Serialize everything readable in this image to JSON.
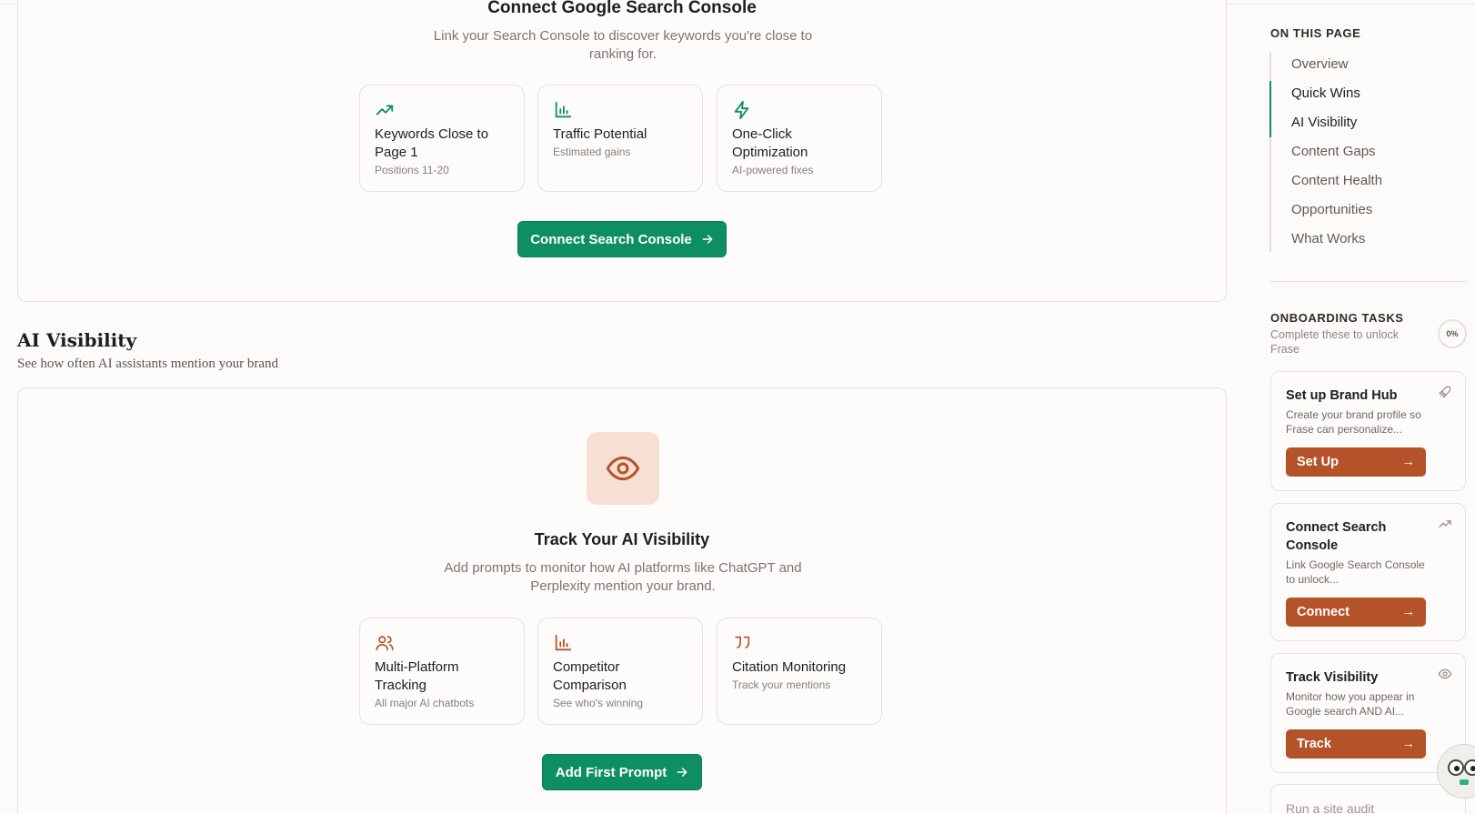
{
  "gsc_section": {
    "title": "Connect Google Search Console",
    "description": "Link your Search Console to discover keywords you're close to ranking for.",
    "features": [
      {
        "icon": "trending-up-icon",
        "title": "Keywords Close to Page 1",
        "subtitle": "Positions 11-20"
      },
      {
        "icon": "bar-chart-icon",
        "title": "Traffic Potential",
        "subtitle": "Estimated gains"
      },
      {
        "icon": "lightning-icon",
        "title": "One-Click Optimization",
        "subtitle": "AI-powered fixes"
      }
    ],
    "button_label": "Connect Search Console"
  },
  "ai_section": {
    "heading": "AI Visibility",
    "subheading": "See how often AI assistants mention your brand",
    "card_title": "Track Your AI Visibility",
    "card_description": "Add prompts to monitor how AI platforms like ChatGPT and Perplexity mention your brand.",
    "features": [
      {
        "icon": "users-icon",
        "title": "Multi-Platform Tracking",
        "subtitle": "All major AI chatbots"
      },
      {
        "icon": "bar-chart-icon",
        "title": "Competitor Comparison",
        "subtitle": "See who's winning"
      },
      {
        "icon": "quote-icon",
        "title": "Citation Monitoring",
        "subtitle": "Track your mentions"
      }
    ],
    "button_label": "Add First Prompt"
  },
  "toc": {
    "heading": "ON THIS PAGE",
    "items": [
      "Overview",
      "Quick Wins",
      "AI Visibility",
      "Content Gaps",
      "Content Health",
      "Opportunities",
      "What Works"
    ],
    "active": [
      "Quick Wins",
      "AI Visibility"
    ]
  },
  "onboarding": {
    "heading": "ONBOARDING TASKS",
    "subtitle": "Complete these to unlock Frase",
    "progress": "0%",
    "tasks": [
      {
        "title": "Set up Brand Hub",
        "description": "Create your brand profile so Frase can personalize...",
        "button": "Set Up",
        "icon": "rocket-icon"
      },
      {
        "title": "Connect Search Console",
        "description": "Link Google Search Console to unlock...",
        "button": "Connect",
        "icon": "trending-up-icon"
      },
      {
        "title": "Track Visibility",
        "description": "Monitor how you appear in Google search AND AI...",
        "button": "Track",
        "icon": "eye-icon"
      },
      {
        "title": "Run a site audit"
      }
    ]
  },
  "colors": {
    "accent_green": "#0d8f63",
    "accent_orange": "#b4532a",
    "eye_bg": "#f6dfd4"
  }
}
